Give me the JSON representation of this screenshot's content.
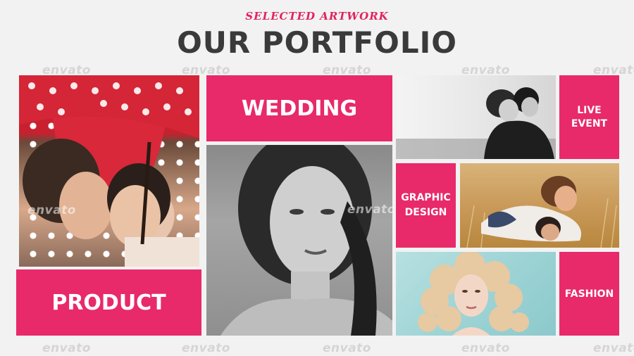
{
  "header": {
    "eyebrow": "SELECTED ARTWORK",
    "title": "OUR PORTFOLIO"
  },
  "tiles": {
    "wedding": "WEDDING",
    "live_event": "LIVE\nEVENT",
    "graphic_design": "GRAPHIC\nDESIGN",
    "product": "PRODUCT",
    "fashion": "FASHION"
  },
  "watermark": "envato",
  "colors": {
    "accent": "#e8296a",
    "title": "#3a3a3a",
    "background": "#f2f2f2"
  },
  "photos": [
    "couple-under-umbrella-photo",
    "bw-woman-portrait-photo",
    "bw-couple-embrace-photo",
    "couple-in-field-photo",
    "curly-hair-woman-photo"
  ]
}
